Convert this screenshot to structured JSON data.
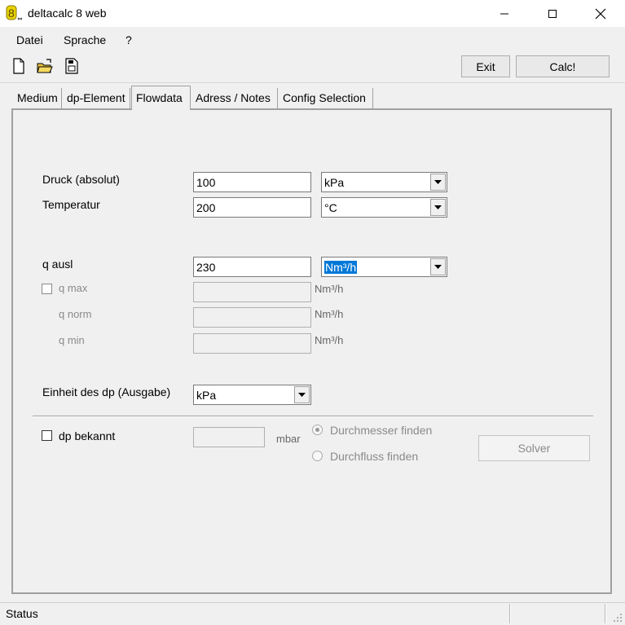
{
  "window": {
    "title": "deltacalc 8 web",
    "icon": "deltacalc-app-icon",
    "controls": [
      "minimize-icon",
      "maximize-icon",
      "close-icon"
    ]
  },
  "menu": {
    "items": [
      {
        "label": "Datei"
      },
      {
        "label": "Sprache"
      },
      {
        "label": "?"
      }
    ]
  },
  "toolbar": {
    "icons": [
      "new-file-icon",
      "open-folder-icon",
      "save-icon"
    ],
    "exit_label": "Exit",
    "calc_label": "Calc!"
  },
  "tabs": [
    {
      "label": "Medium",
      "active": false
    },
    {
      "label": "dp-Element",
      "active": false
    },
    {
      "label": "Flowdata",
      "active": true
    },
    {
      "label": "Adress / Notes",
      "active": false
    },
    {
      "label": "Config Selection",
      "active": false
    }
  ],
  "form": {
    "druck": {
      "label": "Druck (absolut)",
      "value": "100",
      "unit": "kPa"
    },
    "temperatur": {
      "label": "Temperatur",
      "value": "200",
      "unit": "°C"
    },
    "q_ausl": {
      "label": "q ausl",
      "value": "230",
      "unit": "Nm³/h"
    },
    "q_max": {
      "label": "q max",
      "value": "",
      "unit": "Nm³/h",
      "checked": false
    },
    "q_norm": {
      "label": "q norm",
      "value": "",
      "unit": "Nm³/h"
    },
    "q_min": {
      "label": "q min",
      "value": "",
      "unit": "Nm³/h"
    },
    "einheit_dp": {
      "label": "Einheit des dp (Ausgabe)",
      "value": "kPa"
    },
    "dp_bekannt": {
      "label": "dp bekannt",
      "value": "",
      "unit": "mbar",
      "checked": false
    },
    "radio_durchmesser": {
      "label": "Durchmesser finden",
      "selected": true
    },
    "radio_durchfluss": {
      "label": "Durchfluss finden",
      "selected": false
    },
    "solver_label": "Solver"
  },
  "status": {
    "text": "Status"
  },
  "colors": {
    "accent": "#0078d7",
    "window_bg": "#f0f0f0",
    "disabled_text": "#8a8a8a"
  }
}
